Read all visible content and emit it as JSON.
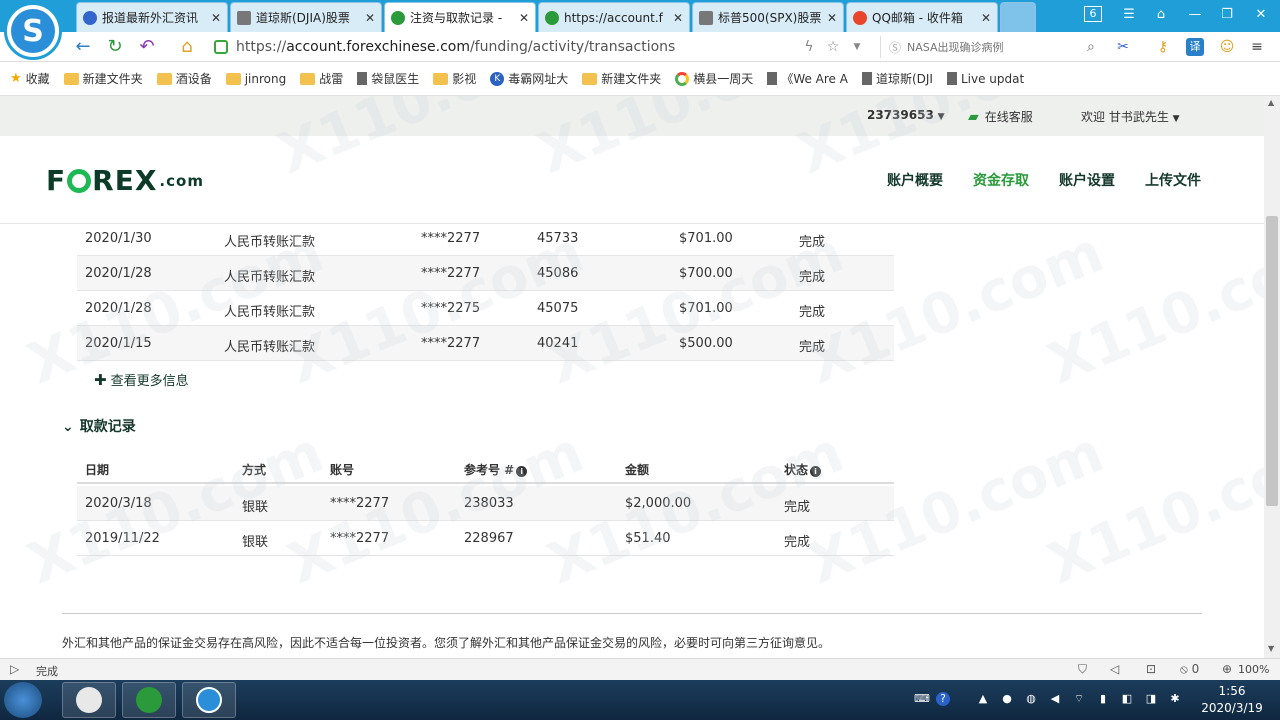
{
  "browser": {
    "tabs": [
      {
        "label": "报道最新外汇资讯",
        "icon_color": "#3366cc"
      },
      {
        "label": "道琼斯(DJIA)股票",
        "icon_color": "#777777"
      },
      {
        "label": "注资与取款记录 -",
        "icon_color": "#2a9a3a"
      },
      {
        "label": "https://account.f",
        "icon_color": "#2a9a3a"
      },
      {
        "label": "标普500(SPX)股票",
        "icon_color": "#777777"
      },
      {
        "label": "QQ邮箱 - 收件箱",
        "icon_color": "#e8452c"
      }
    ],
    "tab_counter": "6",
    "url_scheme": "https://",
    "url_host": "account.forexchinese.com",
    "url_path": "/funding/activity/transactions",
    "search_placeholder": "NASA出现确诊病例",
    "bookmarks": [
      {
        "label": "收藏",
        "type": "star"
      },
      {
        "label": "新建文件夹",
        "type": "folder"
      },
      {
        "label": "酒设备",
        "type": "folder"
      },
      {
        "label": "jinrong",
        "type": "folder"
      },
      {
        "label": "战雷",
        "type": "folder"
      },
      {
        "label": "袋鼠医生",
        "type": "doc"
      },
      {
        "label": "影视",
        "type": "folder"
      },
      {
        "label": "毒霸网址大",
        "type": "k"
      },
      {
        "label": "新建文件夹",
        "type": "folder"
      },
      {
        "label": "横县一周天",
        "type": "g"
      },
      {
        "label": "《We Are A",
        "type": "doc"
      },
      {
        "label": "道琼斯(DJI",
        "type": "doc"
      },
      {
        "label": "Live updat",
        "type": "doc"
      }
    ],
    "status_text": "完成",
    "status_count": "0",
    "zoom": "100%"
  },
  "site": {
    "account_number": "23739653",
    "online_support": "在线客服",
    "welcome": "欢迎 甘书武先生",
    "logo_f": "F",
    "logo_rex": "REX",
    "logo_com": ".com",
    "nav": [
      {
        "label": "账户概要",
        "active": false
      },
      {
        "label": "资金存取",
        "active": true
      },
      {
        "label": "账户设置",
        "active": false
      },
      {
        "label": "上传文件",
        "active": false
      }
    ]
  },
  "deposits": {
    "rows": [
      {
        "date": "2020/1/30",
        "method": "人民币转账汇款",
        "account": "****2277",
        "ref": "45733",
        "amount": "$701.00",
        "status": "完成"
      },
      {
        "date": "2020/1/28",
        "method": "人民币转账汇款",
        "account": "****2277",
        "ref": "45086",
        "amount": "$700.00",
        "status": "完成"
      },
      {
        "date": "2020/1/28",
        "method": "人民币转账汇款",
        "account": "****2275",
        "ref": "45075",
        "amount": "$701.00",
        "status": "完成"
      },
      {
        "date": "2020/1/15",
        "method": "人民币转账汇款",
        "account": "****2277",
        "ref": "40241",
        "amount": "$500.00",
        "status": "完成"
      }
    ],
    "more_label": "查看更多信息"
  },
  "withdrawals": {
    "title": "取款记录",
    "headers": {
      "date": "日期",
      "method": "方式",
      "account": "账号",
      "ref": "参考号 #",
      "amount": "金额",
      "status": "状态"
    },
    "rows": [
      {
        "date": "2020/3/18",
        "method": "银联",
        "account": "****2277",
        "ref": "238033",
        "amount": "$2,000.00",
        "status": "完成"
      },
      {
        "date": "2019/11/22",
        "method": "银联",
        "account": "****2277",
        "ref": "228967",
        "amount": "$51.40",
        "status": "完成"
      }
    ]
  },
  "disclaimer": "外汇和其他产品的保证金交易存在高风险，因此不适合每一位投资者。您须了解外汇和其他产品保证金交易的风险，必要时可向第三方征询意见。",
  "watermark": "X110.com",
  "taskbar": {
    "time": "1:56",
    "date": "2020/3/19"
  }
}
